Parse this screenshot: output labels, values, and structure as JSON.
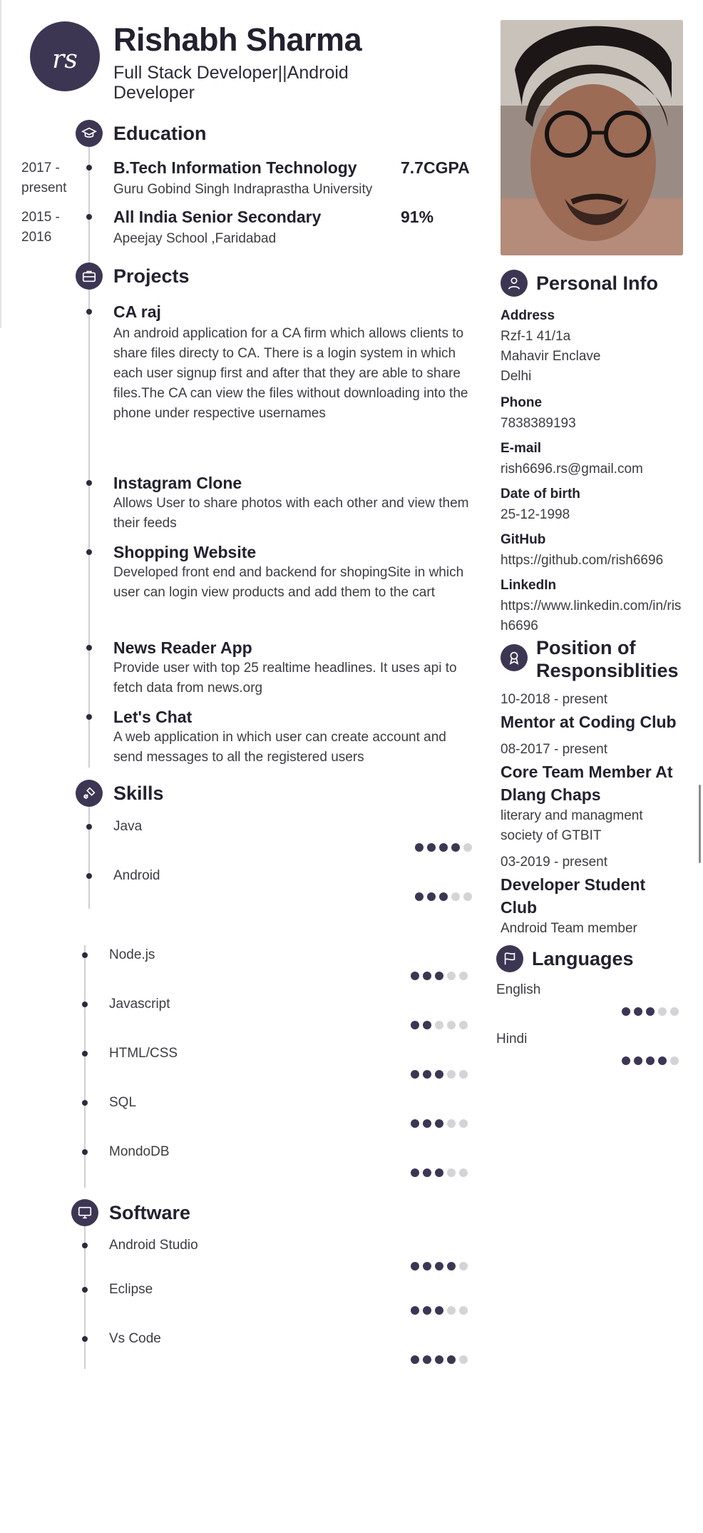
{
  "header": {
    "monogram": "rs",
    "name": "Rishabh Sharma",
    "title": "Full Stack Developer||Android Developer"
  },
  "education": {
    "title": "Education",
    "items": [
      {
        "date": "2017 - present",
        "degree": "B.Tech Information Technology",
        "school": "Guru Gobind Singh Indraprastha University",
        "grade": "7.7CGPA"
      },
      {
        "date": "2015 - 2016",
        "degree": "All India Senior Secondary",
        "school": "Apeejay School ,Faridabad",
        "grade": "91%"
      }
    ]
  },
  "projects": {
    "title": "Projects",
    "items": [
      {
        "name": "CA raj",
        "desc": "An android application for a CA firm which allows clients to share files directy to CA. There is a login system in which each user signup first and after that they are able to share files.The CA can view the files without downloading into the phone under  respective usernames"
      },
      {
        "name": "Instagram Clone",
        "desc": "Allows User to share photos with each other and view them their feeds"
      },
      {
        "name": "Shopping Website",
        "desc": "Developed front end and backend for shopingSite in which user can login view products and add them to the cart"
      },
      {
        "name": "News Reader App",
        "desc": "Provide user with top 25 realtime headlines. It uses  api to fetch data from news.org"
      },
      {
        "name": "Let's Chat",
        "desc": "A web application in which user can create account and send messages to all the registered users"
      }
    ]
  },
  "skills": {
    "title": "Skills",
    "items": [
      {
        "name": "Java",
        "level": 4
      },
      {
        "name": "Android",
        "level": 3
      },
      {
        "name": "Node.js",
        "level": 3
      },
      {
        "name": "Javascript",
        "level": 2
      },
      {
        "name": "HTML/CSS",
        "level": 3
      },
      {
        "name": "SQL",
        "level": 3
      },
      {
        "name": "MondoDB",
        "level": 3
      }
    ]
  },
  "software": {
    "title": "Software",
    "items": [
      {
        "name": "Android Studio",
        "level": 4
      },
      {
        "name": "Eclipse",
        "level": 3
      },
      {
        "name": "Vs Code",
        "level": 4
      }
    ]
  },
  "personal": {
    "title": "Personal Info",
    "address_label": "Address",
    "address": [
      "Rzf-1 41/1a",
      "Mahavir Enclave",
      "Delhi"
    ],
    "phone_label": "Phone",
    "phone": "7838389193",
    "email_label": "E-mail",
    "email": "rish6696.rs@gmail.com",
    "dob_label": "Date of birth",
    "dob": "25-12-1998",
    "github_label": "GitHub",
    "github": "https://github.com/rish6696",
    "linkedin_label": "LinkedIn",
    "linkedin": "https://www.linkedin.com/in/rish6696"
  },
  "positions": {
    "title": "Position of Responsiblities",
    "items": [
      {
        "date": "10-2018 - present",
        "title": "Mentor at Coding Club",
        "sub": ""
      },
      {
        "date": "08-2017 - present",
        "title": "Core Team Member At Dlang Chaps",
        "sub": "literary and managment society of GTBIT"
      },
      {
        "date": "03-2019 - present",
        "title": "Developer Student Club",
        "sub": "Android Team member"
      }
    ]
  },
  "languages": {
    "title": "Languages",
    "items": [
      {
        "name": "English",
        "level": 3
      },
      {
        "name": "Hindi",
        "level": 4
      }
    ]
  },
  "rating_max": 5,
  "colors": {
    "accent": "#3d3653",
    "text": "#24212f",
    "muted": "#3c3c44",
    "dot_off": "#d4d4d8"
  }
}
